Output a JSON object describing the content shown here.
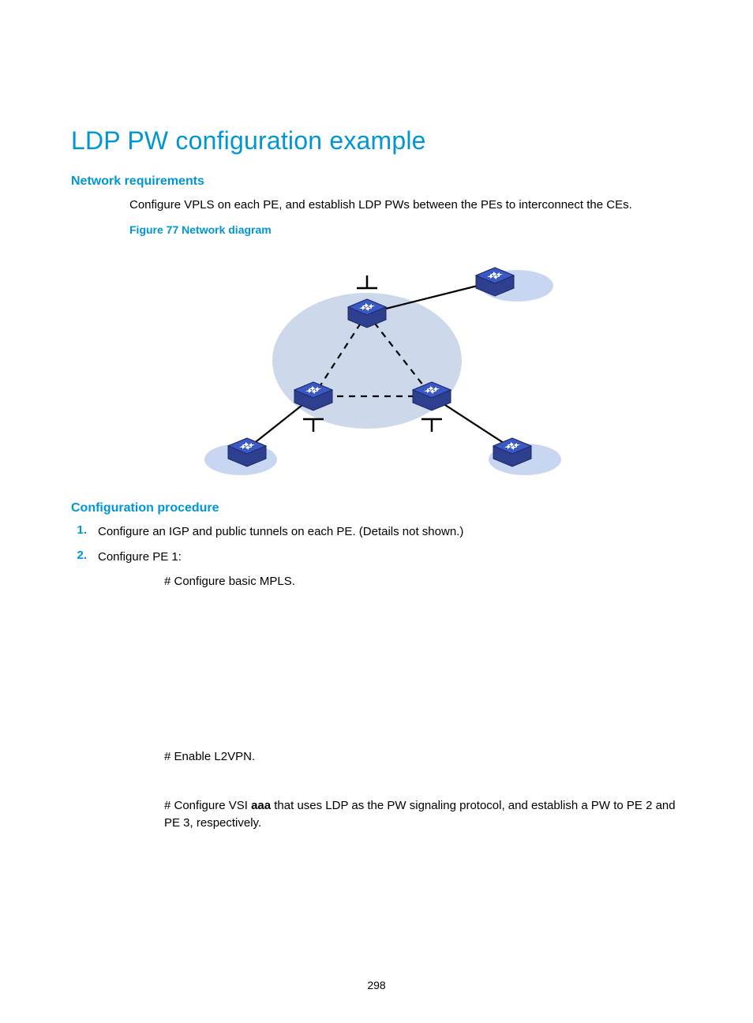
{
  "page": {
    "title": "LDP PW configuration example",
    "number": "298"
  },
  "sections": {
    "netreq": {
      "heading": "Network requirements",
      "intro": "Configure VPLS on each PE, and establish LDP PWs between the PEs to interconnect the CEs.",
      "figcap": "Figure 77 Network diagram"
    },
    "confproc": {
      "heading": "Configuration procedure",
      "steps": [
        {
          "num": "1.",
          "text": "Configure an IGP and public tunnels on each PE. (Details not shown.)"
        },
        {
          "num": "2.",
          "text": "Configure PE 1:"
        }
      ],
      "sub": {
        "mpls": "# Configure basic MPLS.",
        "l2vpn": "# Enable L2VPN.",
        "vsi_pre": "# Configure VSI ",
        "vsi_kw": "aaa",
        "vsi_post": " that uses LDP as the PW signaling protocol, and establish a PW to PE 2 and PE 3, respectively."
      }
    }
  }
}
